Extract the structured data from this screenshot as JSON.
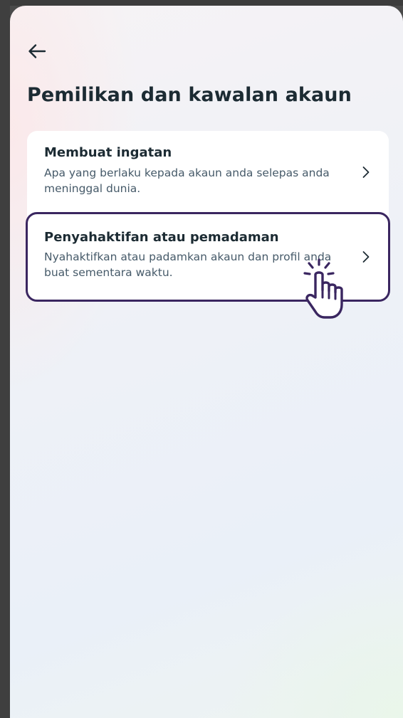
{
  "header": {
    "back_icon": "arrow-left-icon",
    "title": "Pemilikan dan kawalan akaun"
  },
  "settings_list": {
    "items": [
      {
        "title": "Membuat ingatan",
        "description": "Apa yang berlaku kepada akaun anda selepas anda meninggal dunia.",
        "icon": "chevron-right-icon"
      },
      {
        "title": "Penyahaktifan atau pemadaman",
        "description": "Nyahaktifkan atau padamkan akaun dan profil anda buat sementara waktu.",
        "icon": "chevron-right-icon",
        "highlighted": true
      }
    ]
  },
  "overlay": {
    "cursor_icon": "hand-pointer-click-icon"
  },
  "colors": {
    "title_text": "#1c2b33",
    "description_text": "#465a69",
    "highlight_border": "#3a2660",
    "card_background": "#ffffff"
  }
}
